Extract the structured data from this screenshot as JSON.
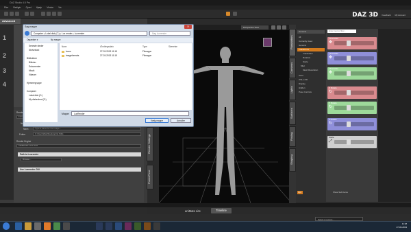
{
  "app": {
    "title": "DAZ Studio 4.5 Pro"
  },
  "menu": [
    "Filer",
    "Redigér",
    "Opret",
    "Hjælp",
    "Vindue",
    "Vis"
  ],
  "top_nav": {
    "logo": "DAZ 3D",
    "links": [
      "Feedback",
      "My Account"
    ]
  },
  "left": {
    "tab": "Advanced",
    "numbers": [
      "1",
      "2",
      "3",
      "4"
    ],
    "render": {
      "render_to_label": "Render To",
      "render_to_value": "Fil Image (Current Frame)",
      "new_window": "New Window",
      "image_file": "Image File",
      "name_label": "Navn",
      "name_placeholder": "Type a name for the image...",
      "folder_label": "Folder",
      "folder_value": "C:\\Users\\Mari\\Desktop\\rip Stills",
      "render_engine_label": "Render Engine",
      "render_engine_value": "Intelliender via Luxus",
      "path_label": "Path to Luxrender",
      "browse": "Browse...",
      "use_gui": "Use Luxrender GUI"
    },
    "side_tabs": [
      "Render Settings",
      "PowerPose"
    ]
  },
  "viewport": {
    "label": "Perspective View"
  },
  "right": {
    "tabs": [
      "Parameters",
      "Cameras",
      "Lights",
      "Surfaces",
      "Posing",
      "Shaping"
    ],
    "search_placeholder": "Enter text to filter...",
    "general_label": "General",
    "tree": [
      "All",
      "Currently Used",
      "General",
      "Transforms",
      "Translation",
      "Rotation",
      "Scale",
      "Misc",
      "Mesh Resolution",
      "Actor",
      "OSL-LOD",
      "Display",
      "Hidden",
      "Pose Controls"
    ],
    "groups": [
      {
        "title": "xTranslate",
        "color": "#d98a8e"
      },
      {
        "title": "yTranslate",
        "color": "#8f8fd9"
      },
      {
        "title": "zTranslate",
        "color": "#9dd99a"
      },
      {
        "title": "X Rotate",
        "color": "#d98a8e"
      },
      {
        "title": "Y Rotate",
        "color": "#9dd99a"
      },
      {
        "title": "Z Rotate",
        "color": "#8f8fd9"
      },
      {
        "title": "Scale",
        "color": "#cfcfcf"
      }
    ],
    "show_sub_items": "Show Sub Items",
    "bottom_btn": "Opt"
  },
  "bottom": {
    "tabs": [
      "aniMate Lite",
      "Timeline"
    ],
    "lesson": "Select a Lesson..."
  },
  "taskbar": {
    "time": "11:18",
    "date": "27-03-2013"
  },
  "dialog": {
    "title": "Søg mappe",
    "address": "Computer ▸ Lokal disk (C:) ▸ Lux render ▸ Luxrender",
    "search_placeholder": "Søg Luxrender",
    "toolbar": [
      "Organiser ▾",
      "Ny mappe"
    ],
    "nav": [
      "Seneste steder",
      "Skrivebord",
      "Biblioteker",
      "Billeder",
      "Dokumenter",
      "Musik",
      "Videoer",
      "Hjemmegruppe",
      "Computer",
      "Lokal disk (C:)",
      "My diskenhed (E:)"
    ],
    "columns": [
      "Navn",
      "Ændringsdato",
      "Type",
      "Størrelse"
    ],
    "rows": [
      {
        "name": "Icons",
        "date": "27-03-2013 11:15",
        "type": "Filmappe",
        "size": ""
      },
      {
        "name": "imageformats",
        "date": "27-03-2013 11:15",
        "type": "Filmappe",
        "size": ""
      }
    ],
    "folder_label": "Mappe:",
    "folder_value": "LuxRender",
    "ok": "Vælg mappe",
    "cancel": "Annuller"
  }
}
